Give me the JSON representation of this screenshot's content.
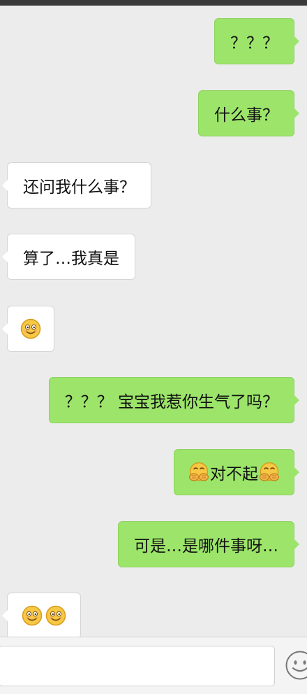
{
  "messages": [
    {
      "side": "sent",
      "text": "？？？"
    },
    {
      "side": "sent",
      "text": "什么事？"
    },
    {
      "side": "recv",
      "text": "还问我什么事？"
    },
    {
      "side": "recv",
      "text": "算了…我真是"
    },
    {
      "side": "recv",
      "emoji": [
        "smile-emoji"
      ]
    },
    {
      "side": "sent",
      "text": "？？？ 宝宝我惹你生气了吗？"
    },
    {
      "side": "sent",
      "text": "对不起",
      "emoji_before": "hands-over-mouth-emoji",
      "emoji_after": "hands-over-mouth-emoji"
    },
    {
      "side": "sent",
      "text": "可是…是哪件事呀…"
    },
    {
      "side": "recv",
      "emoji": [
        "smile-emoji",
        "smile-emoji"
      ]
    }
  ],
  "composer": {
    "input_value": "",
    "emoji_button_icon": "smiley-face-icon"
  },
  "colors": {
    "sent_bubble": "#9ce56a",
    "recv_bubble": "#ffffff",
    "background": "#ececec"
  }
}
